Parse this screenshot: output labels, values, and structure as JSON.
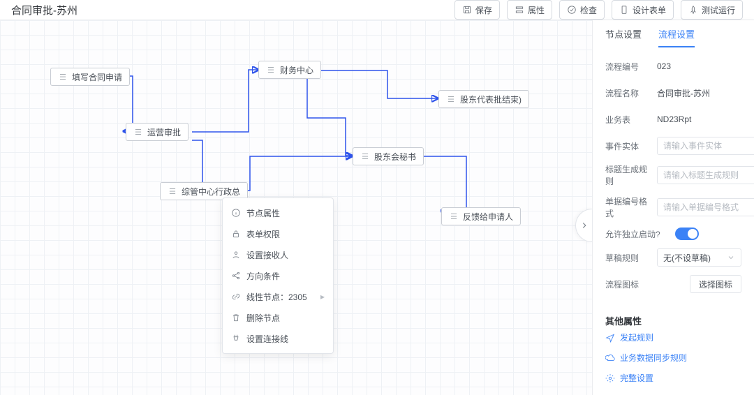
{
  "title": "合同审批-苏州",
  "toolbar": {
    "save": "保存",
    "props": "属性",
    "check": "检查",
    "design_form": "设计表单",
    "test_run": "测试运行"
  },
  "nodes": {
    "fill": "填写合同申请",
    "ops": "运营审批",
    "finance": "财务中心",
    "admin": "综管中心行政总",
    "shareholder_end": "股东代表批结束)",
    "secretary": "股东会秘书",
    "feedback": "反馈给申请人"
  },
  "ctx": {
    "node_props": "节点属性",
    "table_perm": "表单权限",
    "set_receiver": "设置接收人",
    "direction_cond": "方向条件",
    "linear_node": "线性节点：2305",
    "delete_node": "删除节点",
    "set_connector": "设置连接线"
  },
  "tabs": {
    "node": "节点设置",
    "flow": "流程设置"
  },
  "form": {
    "flow_no_label": "流程编号",
    "flow_no": "023",
    "flow_name_label": "流程名称",
    "flow_name": "合同审批-苏州",
    "biz_table_label": "业务表",
    "biz_table": "ND23Rpt",
    "event_entity_label": "事件实体",
    "event_entity_ph": "请输入事件实体",
    "title_rule_label": "标题生成规则",
    "title_rule_ph": "请输入标题生成规则",
    "bill_fmt_label": "单据编号格式",
    "bill_fmt_ph": "请输入单据编号格式",
    "indep_start_label": "允许独立启动?",
    "draft_rule_label": "草稿规则",
    "draft_rule_value": "无(不设草稿)",
    "flow_icon_label": "流程图标",
    "flow_icon_btn": "选择图标"
  },
  "other": {
    "title": "其他属性",
    "launch_rule": "发起规则",
    "sync_rule": "业务数据同步规则",
    "full_settings": "完整设置"
  },
  "more_glyph": "▸"
}
